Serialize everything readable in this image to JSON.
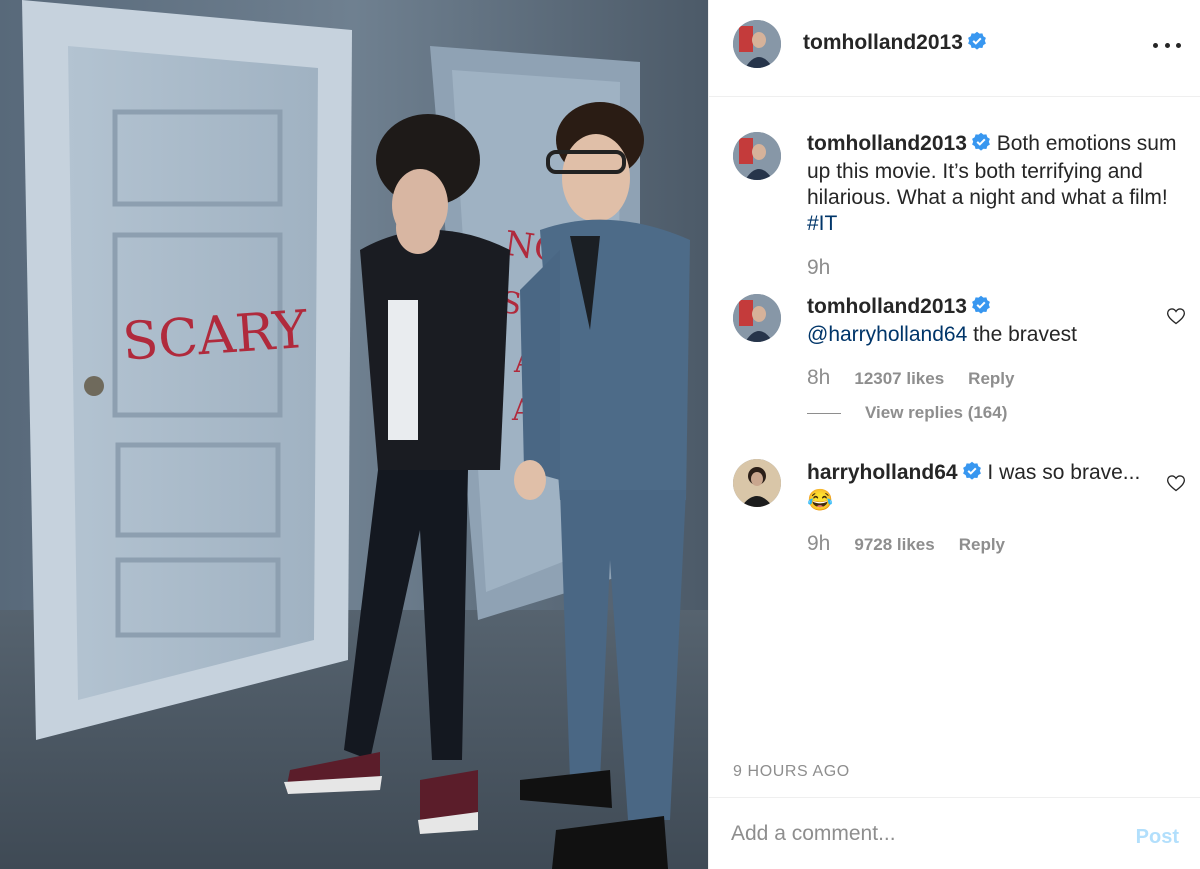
{
  "post": {
    "author": "tomholland2013",
    "caption_text": "Both emotions sum up this movie. It’s both terrifying and hilarious. What a night and what a film!",
    "caption_hashtag": "#IT",
    "caption_time": "9h",
    "posted_ago": "9 HOURS AGO",
    "photo_wall_text": [
      "SCARY",
      "NOT",
      "SCARY",
      "AT",
      "ALL"
    ]
  },
  "comments": [
    {
      "author": "tomholland2013",
      "mention": "@harryholland64",
      "text": "the bravest",
      "time": "8h",
      "likes": "12307 likes",
      "reply_label": "Reply",
      "view_replies": "View replies (164)"
    },
    {
      "author": "harryholland64",
      "text": "I was so brave... 😂",
      "time": "9h",
      "likes": "9728 likes",
      "reply_label": "Reply"
    }
  ],
  "composer": {
    "placeholder": "Add a comment...",
    "post_label": "Post"
  },
  "colors": {
    "verified": "#3897f0",
    "link": "#003569",
    "muted": "#8e8e8e",
    "post_disabled": "#b2dffc"
  },
  "icons": [
    "verified-badge-icon",
    "more-options-icon",
    "heart-outline-icon"
  ]
}
